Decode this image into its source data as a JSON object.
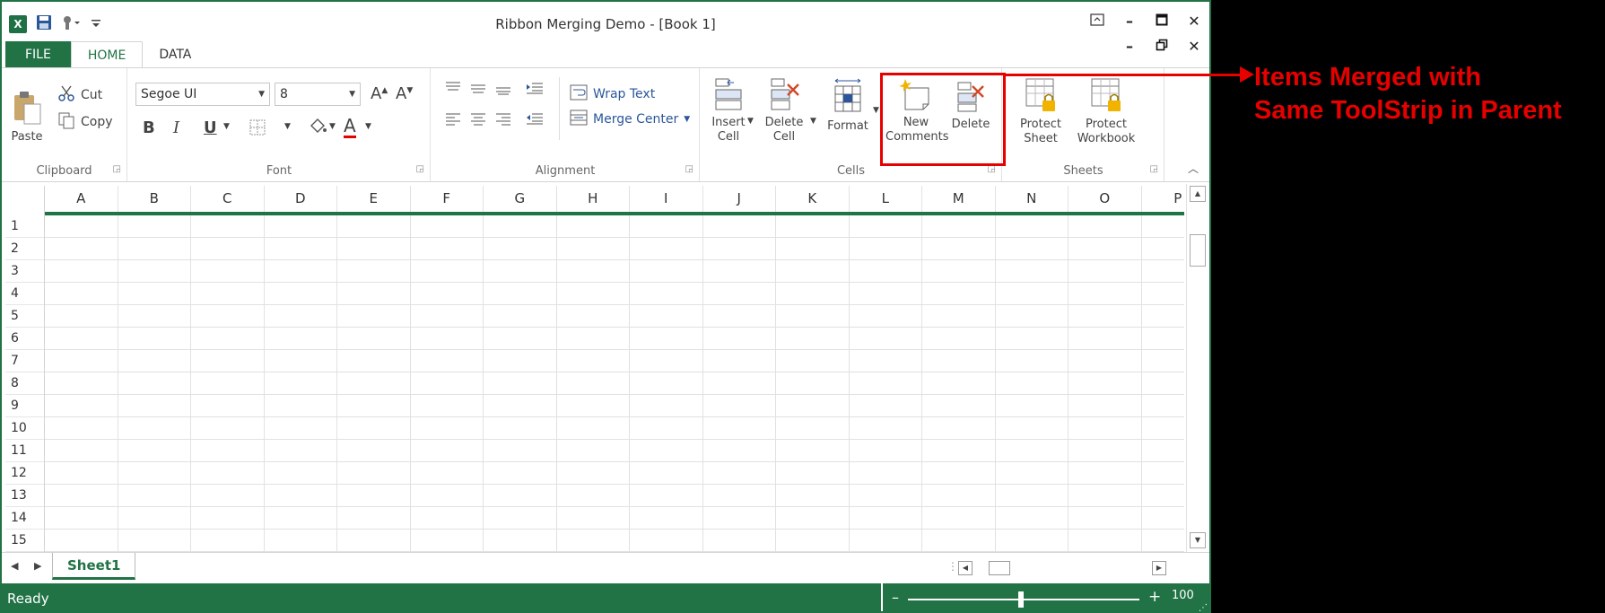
{
  "window": {
    "title": "Ribbon Merging Demo - [Book 1]",
    "accent": "#217346"
  },
  "qat": {
    "app_icon": "excel-icon",
    "save_icon": "save-icon",
    "touch_icon": "touch-mode-icon",
    "customize_icon": "customize-qat-icon"
  },
  "tabs": [
    {
      "label": "FILE"
    },
    {
      "label": "HOME"
    },
    {
      "label": "DATA"
    }
  ],
  "ribbon": {
    "clipboard": {
      "label": "Clipboard",
      "paste": "Paste",
      "cut": "Cut",
      "copy": "Copy"
    },
    "font": {
      "label": "Font",
      "font_name": "Segoe UI",
      "font_size": "8",
      "bold": "B",
      "italic": "I",
      "underline": "U",
      "font_color": "A"
    },
    "alignment": {
      "label": "Alignment",
      "wrap_text": "Wrap Text",
      "merge_center": "Merge  Center"
    },
    "cells": {
      "label": "Cells",
      "insert_line1": "Insert",
      "insert_line2": "Cell",
      "delete_line1": "Delete",
      "delete_line2": "Cell",
      "format": "Format",
      "new_comments_line1": "New",
      "new_comments_line2": "Comments",
      "delete_comment": "Delete"
    },
    "sheets": {
      "label": "Sheets",
      "protect_sheet_line1": "Protect",
      "protect_sheet_line2": "Sheet",
      "protect_workbook_line1": "Protect",
      "protect_workbook_line2": "Workbook"
    }
  },
  "grid": {
    "columns": [
      "A",
      "B",
      "C",
      "D",
      "E",
      "F",
      "G",
      "H",
      "I",
      "J",
      "K",
      "L",
      "M",
      "N",
      "O",
      "P"
    ],
    "rows": [
      "1",
      "2",
      "3",
      "4",
      "5",
      "6",
      "7",
      "8",
      "9",
      "10",
      "11",
      "12",
      "13",
      "14",
      "15"
    ]
  },
  "sheet_tabs": [
    {
      "label": "Sheet1"
    }
  ],
  "status": {
    "text": "Ready",
    "zoom": "100",
    "zoom_fraction": 0.5
  },
  "annotation": {
    "line1": "Items Merged with",
    "line2": "Same ToolStrip in Parent",
    "color": "#e60000"
  }
}
